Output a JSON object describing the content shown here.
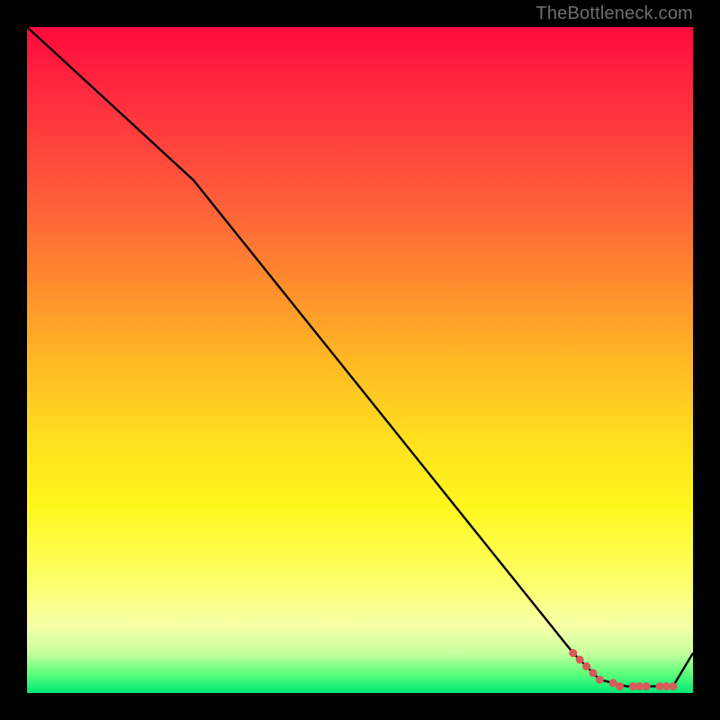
{
  "watermark": {
    "text": "TheBottleneck.com"
  },
  "colors": {
    "line": "#000000",
    "marker": "#d85a5a",
    "marker_stroke": "#d85a5a"
  },
  "chart_data": {
    "type": "line",
    "title": "",
    "xlabel": "",
    "ylabel": "",
    "xlim": [
      0,
      100
    ],
    "ylim": [
      0,
      100
    ],
    "series": [
      {
        "name": "curve",
        "x": [
          0,
          25,
          82,
          86,
          90,
          94,
          97,
          100
        ],
        "y": [
          100,
          77,
          6,
          2,
          1,
          1,
          1,
          6
        ]
      }
    ],
    "markers": {
      "name": "points",
      "x": [
        82,
        83,
        84,
        85,
        86,
        88,
        89,
        91,
        92,
        93,
        95,
        96,
        97
      ],
      "y": [
        6,
        5,
        4,
        3,
        2,
        1.5,
        1,
        1,
        1,
        1,
        1,
        1,
        1
      ]
    }
  }
}
